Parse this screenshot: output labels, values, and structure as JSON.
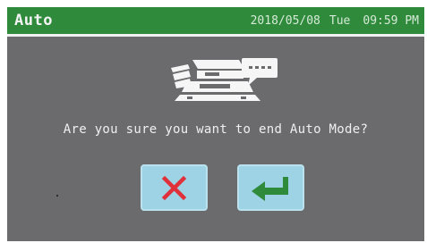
{
  "header": {
    "mode_title": "Auto",
    "date": "2018/05/08",
    "day": "Tue",
    "time": "09:59 PM"
  },
  "dialog": {
    "message": "Are you sure you want to end Auto Mode?",
    "illustration_icons": [
      "auto-machine-icon",
      "speech-bubble-icon"
    ]
  },
  "buttons": {
    "cancel_icon": "close-icon",
    "confirm_icon": "enter-return-icon"
  },
  "colors": {
    "header_bg": "#2f8a3c",
    "screen_bg": "#6b6b6d",
    "button_bg": "#9dd3e4",
    "cancel_red": "#e0303a",
    "confirm_green": "#2f8a3c"
  }
}
